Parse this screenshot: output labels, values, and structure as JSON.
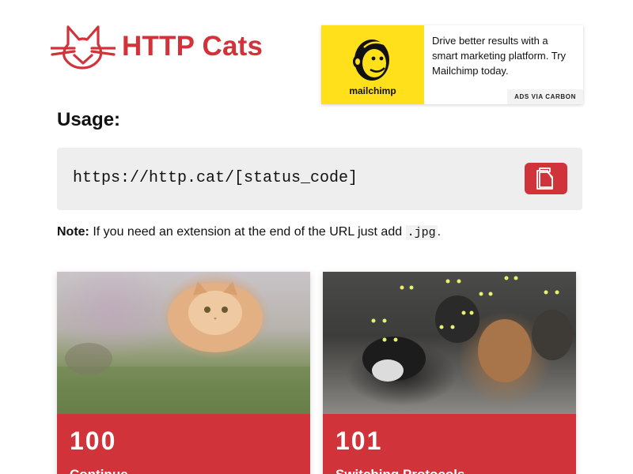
{
  "header": {
    "title": "HTTP Cats"
  },
  "ad": {
    "brand": "mailchimp",
    "text": "Drive better results with a smart marketing platform. Try Mailchimp today.",
    "via": "ADS VIA CARBON"
  },
  "usage": {
    "heading": "Usage:",
    "url": "https://http.cat/[status_code]"
  },
  "note": {
    "label": "Note:",
    "text": " If you need an extension at the end of the URL just add ",
    "ext": ".jpg",
    "end": "."
  },
  "cards": [
    {
      "code": "100",
      "label": "Continue"
    },
    {
      "code": "101",
      "label": "Switching Protocols"
    }
  ],
  "colors": {
    "accent": "#d0343a",
    "ad_yellow": "#ffe01b",
    "code_bg": "#eeeeee"
  },
  "icons": {
    "logo": "cat-logo-icon",
    "copy": "copy-icon",
    "ad": "mailchimp-logo-icon"
  }
}
